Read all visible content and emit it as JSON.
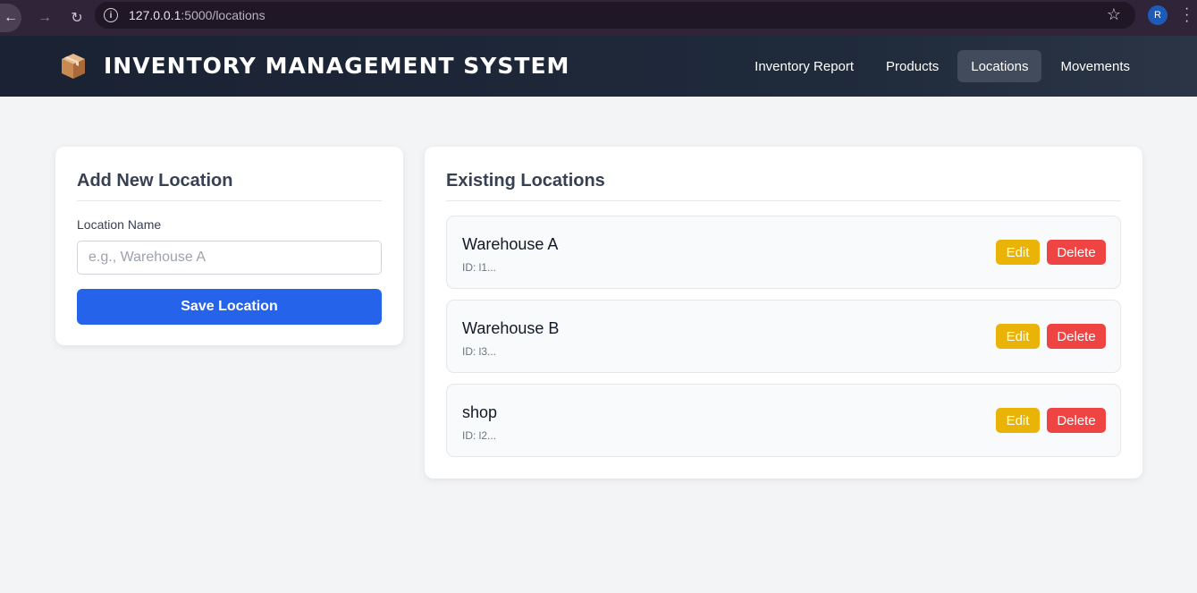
{
  "browser": {
    "url_host": "127.0.0.1",
    "url_path": ":5000/locations",
    "profile_initial": "R"
  },
  "header": {
    "title": "INVENTORY MANAGEMENT SYSTEM",
    "logo_icon": "package-box-icon",
    "nav": [
      {
        "label": "Inventory Report",
        "active": false
      },
      {
        "label": "Products",
        "active": false
      },
      {
        "label": "Locations",
        "active": true
      },
      {
        "label": "Movements",
        "active": false
      }
    ]
  },
  "add_form": {
    "title": "Add New Location",
    "field_label": "Location Name",
    "placeholder": "e.g., Warehouse A",
    "value": "",
    "submit_label": "Save Location"
  },
  "locations_panel": {
    "title": "Existing Locations",
    "items": [
      {
        "name": "Warehouse A",
        "id_text": "ID: l1...",
        "edit_label": "Edit",
        "delete_label": "Delete"
      },
      {
        "name": "Warehouse B",
        "id_text": "ID: l3...",
        "edit_label": "Edit",
        "delete_label": "Delete"
      },
      {
        "name": "shop",
        "id_text": "ID: l2...",
        "edit_label": "Edit",
        "delete_label": "Delete"
      }
    ]
  },
  "colors": {
    "primary": "#2563eb",
    "edit": "#eab308",
    "delete": "#ef4444",
    "header_bg": "#1a2233"
  }
}
